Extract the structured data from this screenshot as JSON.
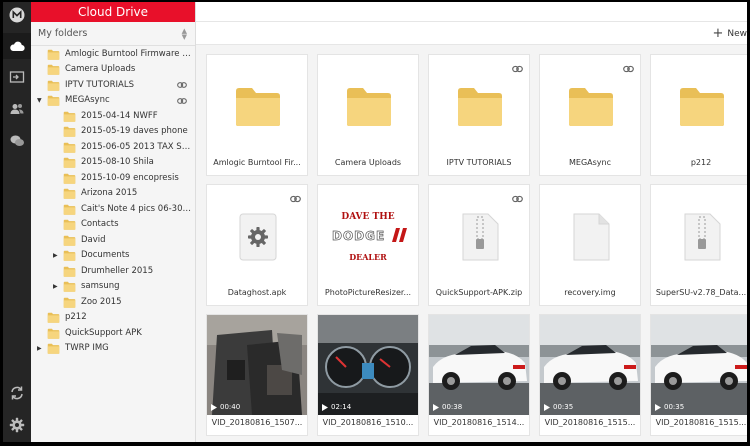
{
  "app": {
    "brand_title": "Cloud Drive"
  },
  "rail": {
    "items": [
      {
        "icon": "mega-logo-icon"
      },
      {
        "icon": "cloud-icon"
      },
      {
        "icon": "inbox-icon"
      },
      {
        "icon": "contacts-icon"
      },
      {
        "icon": "chat-icon"
      },
      {
        "icon": "transfers-icon"
      },
      {
        "icon": "settings-icon"
      }
    ]
  },
  "sidebar": {
    "header": "My folders",
    "tree": [
      {
        "label": "Amlogic Burntool Firmware IM...",
        "depth": 0,
        "arrow": "",
        "link": false
      },
      {
        "label": "Camera Uploads",
        "depth": 0,
        "arrow": "",
        "link": false
      },
      {
        "label": "IPTV TUTORIALS",
        "depth": 0,
        "arrow": "",
        "link": true
      },
      {
        "label": "MEGAsync",
        "depth": 0,
        "arrow": "▼",
        "link": true
      },
      {
        "label": "2015-04-14 NWFF",
        "depth": 1,
        "arrow": "",
        "link": false
      },
      {
        "label": "2015-05-19 daves phone",
        "depth": 1,
        "arrow": "",
        "link": false
      },
      {
        "label": "2015-06-05 2013 TAX SUM...",
        "depth": 1,
        "arrow": "",
        "link": false
      },
      {
        "label": "2015-08-10 Shila",
        "depth": 1,
        "arrow": "",
        "link": false
      },
      {
        "label": "2015-10-09 encopresis",
        "depth": 1,
        "arrow": "",
        "link": false
      },
      {
        "label": "Arizona 2015",
        "depth": 1,
        "arrow": "",
        "link": false
      },
      {
        "label": "Cait's Note 4 pics 06-30-2015",
        "depth": 1,
        "arrow": "",
        "link": false
      },
      {
        "label": "Contacts",
        "depth": 1,
        "arrow": "",
        "link": false
      },
      {
        "label": "David",
        "depth": 1,
        "arrow": "",
        "link": false
      },
      {
        "label": "Documents",
        "depth": 1,
        "arrow": "▶",
        "link": false
      },
      {
        "label": "Drumheller 2015",
        "depth": 1,
        "arrow": "",
        "link": false
      },
      {
        "label": "samsung",
        "depth": 1,
        "arrow": "▶",
        "link": false
      },
      {
        "label": "Zoo 2015",
        "depth": 1,
        "arrow": "",
        "link": false
      },
      {
        "label": "p212",
        "depth": 0,
        "arrow": "",
        "link": false
      },
      {
        "label": "QuickSupport APK",
        "depth": 0,
        "arrow": "",
        "link": false
      },
      {
        "label": "TWRP IMG",
        "depth": 0,
        "arrow": "▶",
        "link": false
      }
    ]
  },
  "toolbar": {
    "new_label": "New"
  },
  "grid": [
    {
      "name": "Amlogic Burntool Fir...",
      "kind": "folder",
      "link": false
    },
    {
      "name": "Camera Uploads",
      "kind": "folder",
      "link": false
    },
    {
      "name": "IPTV TUTORIALS",
      "kind": "folder",
      "link": true
    },
    {
      "name": "MEGAsync",
      "kind": "folder",
      "link": true
    },
    {
      "name": "p212",
      "kind": "folder",
      "link": false
    },
    {
      "name": "Dataghost.apk",
      "kind": "apk",
      "link": true
    },
    {
      "name": "PhotoPictureResizer...",
      "kind": "logo",
      "link": false,
      "logo_top": "DAVE  THE",
      "logo_mid": "DODGE",
      "logo_bot": "DEALER"
    },
    {
      "name": "QuickSupport-APK.zip",
      "kind": "zip",
      "link": true
    },
    {
      "name": "recovery.img",
      "kind": "doc",
      "link": false
    },
    {
      "name": "SuperSU-v2.78_Data...",
      "kind": "zip",
      "link": false
    },
    {
      "name": "VID_20180816_1507...",
      "kind": "video",
      "duration": "00:40",
      "scene": "car-door"
    },
    {
      "name": "VID_20180816_1510...",
      "kind": "video",
      "duration": "02:14",
      "scene": "dashboard"
    },
    {
      "name": "VID_20180816_1514...",
      "kind": "video",
      "duration": "00:38",
      "scene": "white-car"
    },
    {
      "name": "VID_20180816_1515...",
      "kind": "video",
      "duration": "00:35",
      "scene": "white-car"
    },
    {
      "name": "VID_20180816_1515...",
      "kind": "video",
      "duration": "00:35",
      "scene": "white-car"
    }
  ],
  "colors": {
    "brand": "#e8102a",
    "folder": "#f5d27a",
    "folder_dark": "#e9bf57",
    "rail": "#252525"
  }
}
